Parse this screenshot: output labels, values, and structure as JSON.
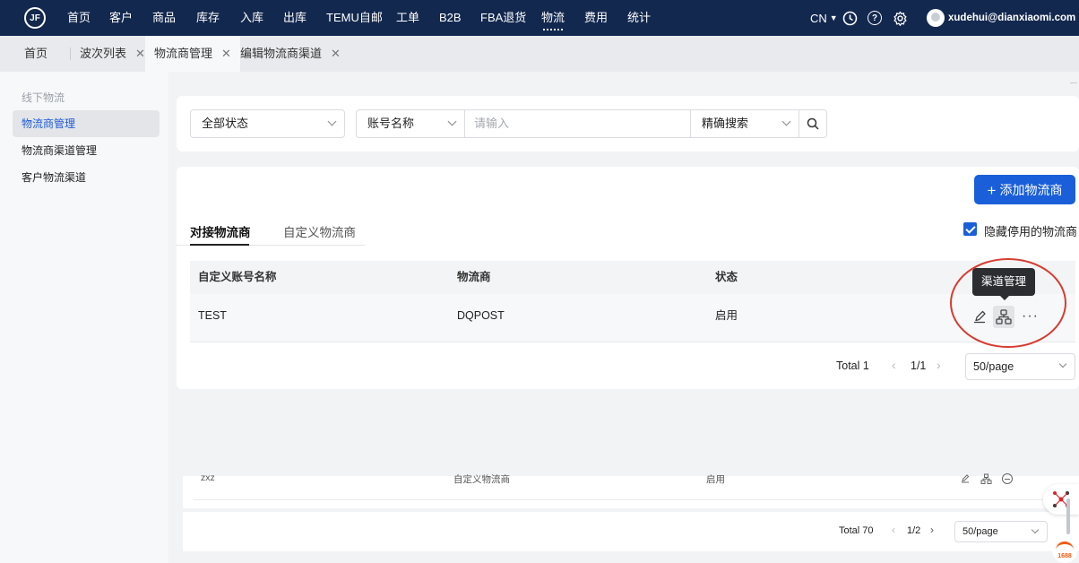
{
  "topnav": {
    "logo": "JF",
    "items": [
      "首页",
      "客户",
      "商品",
      "库存",
      "入库",
      "出库",
      "TEMU自邮",
      "工单",
      "B2B",
      "FBA退货",
      "物流",
      "费用",
      "统计"
    ],
    "active_index": 10,
    "lang": "CN",
    "user": "xudehui@dianxiaomi.com"
  },
  "tabs": [
    {
      "label": "首页",
      "closable": false
    },
    {
      "label": "波次列表",
      "closable": true
    },
    {
      "label": "物流商管理",
      "closable": true,
      "active": true
    },
    {
      "label": "编辑物流商渠道",
      "closable": true
    }
  ],
  "sidebar": {
    "group": "线下物流",
    "items": [
      "物流商管理",
      "物流商渠道管理",
      "客户物流渠道"
    ],
    "active_index": 0
  },
  "filters": {
    "status": "全部状态",
    "field": "账号名称",
    "input_placeholder": "请输入",
    "mode": "精确搜索"
  },
  "actions": {
    "add": "添加物流商",
    "hide_disabled": "隐藏停用的物流商",
    "hide_disabled_checked": true
  },
  "subtabs": [
    "对接物流商",
    "自定义物流商"
  ],
  "table": {
    "columns": [
      "自定义账号名称",
      "物流商",
      "状态"
    ],
    "rows": [
      {
        "name": "TEST",
        "carrier": "DQPOST",
        "status": "启用"
      }
    ]
  },
  "tooltip": "渠道管理",
  "pager": {
    "total": "Total 1",
    "page": "1/1",
    "size": "50/page"
  },
  "lower": {
    "row": {
      "name": "zxz",
      "carrier": "自定义物流商",
      "status": "启用"
    },
    "total": "Total 70",
    "page": "1/2",
    "size": "50/page"
  },
  "colors": {
    "nav": "#13284f",
    "primary": "#1a5fd9",
    "annotation": "#d63b2f"
  }
}
